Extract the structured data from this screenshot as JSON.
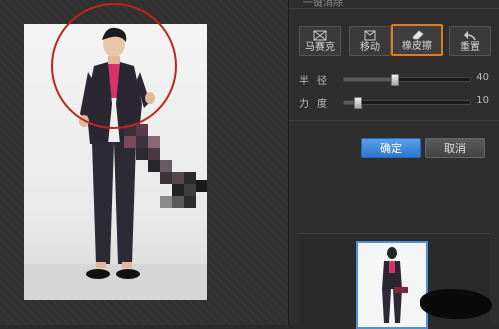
{
  "panel": {
    "title": "一键消除"
  },
  "tools": [
    {
      "label": "马赛克",
      "icon": "mosaic-icon",
      "active": false
    },
    {
      "label": "移动",
      "icon": "move-icon",
      "active": false
    },
    {
      "label": "橡皮擦",
      "icon": "eraser-icon",
      "active": true
    },
    {
      "label": "重置",
      "icon": "undo-icon",
      "active": false
    }
  ],
  "sliders": {
    "radius": {
      "label": "半径",
      "value": "40",
      "level": 0.4
    },
    "strength": {
      "label": "力度",
      "value": "10",
      "level": 0.1
    }
  },
  "buttons": {
    "ok": "确定",
    "cancel": "取消"
  },
  "colors": {
    "accent": "#e07a1f",
    "primary": "#2d78d0",
    "brush": "#c0251c"
  }
}
